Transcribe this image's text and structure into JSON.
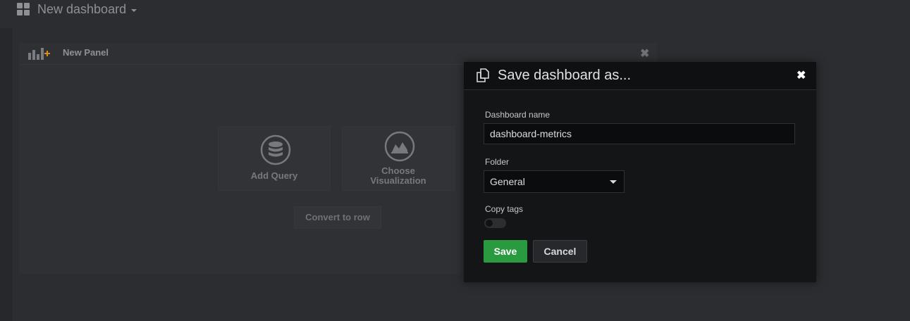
{
  "header": {
    "title": "New dashboard",
    "grid_icon": "dashboard-grid-icon",
    "caret_icon": "caret-down-icon"
  },
  "panel": {
    "title": "New Panel",
    "close": "✖",
    "add_query_label": "Add Query",
    "choose_viz_line1": "Choose",
    "choose_viz_line2": "Visualization",
    "convert_label": "Convert to row"
  },
  "modal": {
    "title": "Save dashboard as...",
    "close": "✖",
    "dashboard_name_label": "Dashboard name",
    "dashboard_name_value": "dashboard-metrics",
    "folder_label": "Folder",
    "folder_value": "General",
    "copy_tags_label": "Copy tags",
    "copy_tags_enabled": false,
    "save_label": "Save",
    "cancel_label": "Cancel"
  },
  "colors": {
    "accent_save": "#2a9a41",
    "background": "#2b2d31",
    "modal_bg": "#141517"
  }
}
